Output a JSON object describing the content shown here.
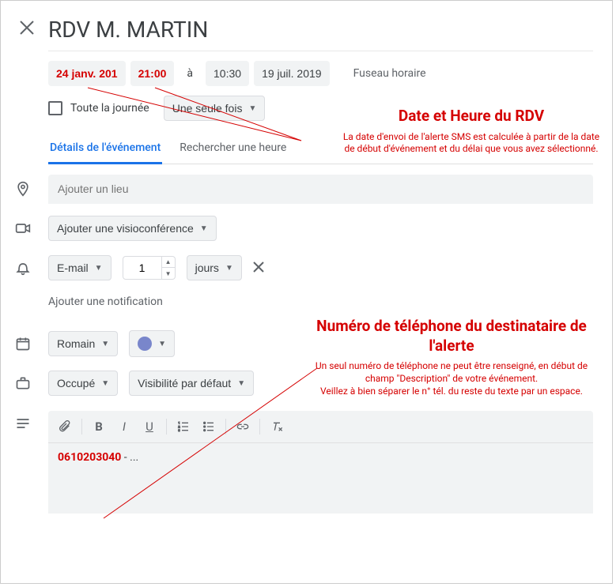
{
  "title": "RDV M. MARTIN",
  "date_row": {
    "start_date": "24 janv. 201",
    "start_time": "21:00",
    "sep": "à",
    "end_time": "10:30",
    "end_date": "19 juil. 2019",
    "timezone_label": "Fuseau horaire"
  },
  "allday": {
    "label": "Toute la journée",
    "recurrence": "Une seule fois"
  },
  "tabs": {
    "details": "Détails de l'événement",
    "find_time": "Rechercher une heure"
  },
  "location_placeholder": "Ajouter un lieu",
  "video_label": "Ajouter une visioconférence",
  "notif": {
    "method": "E-mail",
    "value": "1",
    "unit": "jours",
    "add_label": "Ajouter une notification"
  },
  "calendar": {
    "owner": "Romain"
  },
  "busy": {
    "status": "Occupé",
    "visibility": "Visibilité par défaut"
  },
  "description": {
    "phone": "0610203040",
    "rest": " - ..."
  },
  "annotations": {
    "datetime_title": "Date et Heure du RDV",
    "datetime_sub": "La date d'envoi de l'alerte SMS est calculée à partir de la date de début d'événement et du délai que vous avez sélectionné.",
    "phone_title": "Numéro de téléphone du destinataire de l'alerte",
    "phone_sub": "Un seul numéro de téléphone ne peut être renseigné, en début de champ \"Description\" de votre événement.\nVeillez à bien séparer le n° tél. du reste du texte par un espace."
  }
}
